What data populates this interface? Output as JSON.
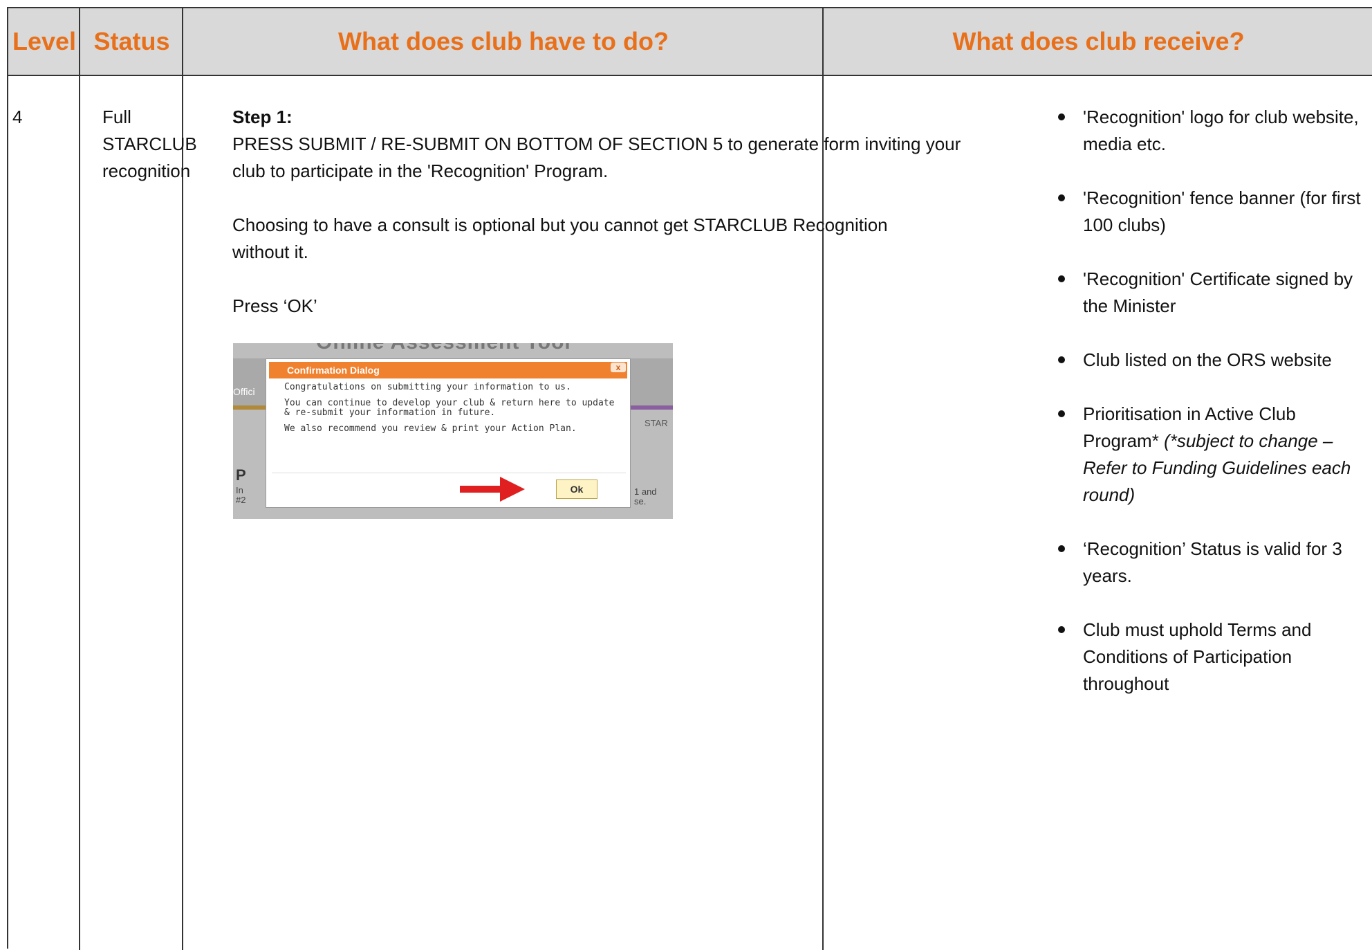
{
  "headers": {
    "level": "Level",
    "status": "Status",
    "todo": "What does club have to do?",
    "receive": "What does club receive?"
  },
  "row": {
    "level": "4",
    "status": [
      "Full",
      "STARCLUB",
      "recognition"
    ],
    "step_title": "Step 1:",
    "step_lines": [
      "PRESS SUBMIT / RE-SUBMIT ON BOTTOM OF SECTION 5 to generate form inviting your",
      "club to participate in the 'Recognition' Program."
    ],
    "consult_lines": [
      "Choosing to have a consult is optional but you cannot get STARCLUB Recognition",
      "without it."
    ],
    "press_ok": "Press ‘OK’",
    "screenshot": {
      "bg_title": "Online Assessment Tool",
      "bg_tab": "Offici",
      "bg_heading": "P",
      "bg_text": [
        "In",
        "#2"
      ],
      "bg_star": "STAR",
      "bg_and": [
        "1 and",
        "se."
      ],
      "dialog_title": "Confirmation Dialog",
      "dialog_close": "x",
      "dialog_lines": [
        "Congratulations on submitting your information to us.",
        "You can continue to develop your club & return here to update & re-submit your information in future.",
        "We also recommend you review & print your Action Plan."
      ],
      "ok_label": "Ok"
    },
    "receive_items": [
      {
        "text": "'Recognition' logo for club website, media etc."
      },
      {
        "text": "'Recognition' fence banner (for first 100 clubs)"
      },
      {
        "text": "'Recognition' Certificate signed by the Minister"
      },
      {
        "text": "Club listed on the ORS website"
      },
      {
        "text": "Prioritisation in Active Club Program*",
        "italic": "(*subject to change – Refer to Funding Guidelines each round)"
      },
      {
        "text": "‘Recognition’ Status is valid for 3 years."
      },
      {
        "text": "Club must uphold Terms and Conditions of Participation throughout"
      }
    ]
  },
  "colors": {
    "header_bg": "#d9d9d9",
    "header_text": "#e8701a",
    "dialog_header": "#f0812f",
    "arrow": "#e02020"
  }
}
